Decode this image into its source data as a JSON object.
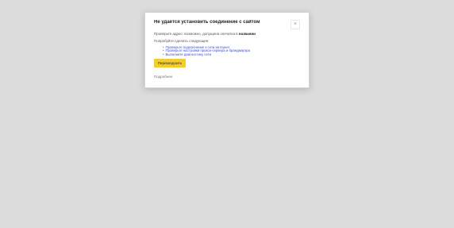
{
  "dialog": {
    "title": "Не удаётся установить соединение с сайтом",
    "close_glyph": "×",
    "message_prefix": "Проверьте адрес: возможно, допущена опечатка в",
    "message_bold": "названии",
    "hint": "Попробуйте сделать следующее:",
    "steps": [
      "Проверьте подключение к сети интернет",
      "Проверьте настройки прокси-сервера и брандмауэра",
      "Выполните диагностику сети"
    ],
    "primary_button": "Перезагрузить",
    "secondary_link": "Подробнее"
  }
}
